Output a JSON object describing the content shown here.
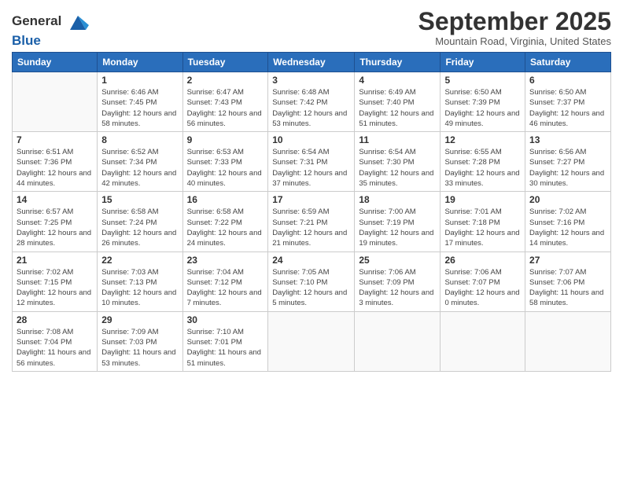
{
  "header": {
    "logo_line1": "General",
    "logo_line2": "Blue",
    "month": "September 2025",
    "location": "Mountain Road, Virginia, United States"
  },
  "weekdays": [
    "Sunday",
    "Monday",
    "Tuesday",
    "Wednesday",
    "Thursday",
    "Friday",
    "Saturday"
  ],
  "weeks": [
    [
      {
        "day": "",
        "empty": true
      },
      {
        "day": "1",
        "sunrise": "Sunrise: 6:46 AM",
        "sunset": "Sunset: 7:45 PM",
        "daylight": "Daylight: 12 hours and 58 minutes."
      },
      {
        "day": "2",
        "sunrise": "Sunrise: 6:47 AM",
        "sunset": "Sunset: 7:43 PM",
        "daylight": "Daylight: 12 hours and 56 minutes."
      },
      {
        "day": "3",
        "sunrise": "Sunrise: 6:48 AM",
        "sunset": "Sunset: 7:42 PM",
        "daylight": "Daylight: 12 hours and 53 minutes."
      },
      {
        "day": "4",
        "sunrise": "Sunrise: 6:49 AM",
        "sunset": "Sunset: 7:40 PM",
        "daylight": "Daylight: 12 hours and 51 minutes."
      },
      {
        "day": "5",
        "sunrise": "Sunrise: 6:50 AM",
        "sunset": "Sunset: 7:39 PM",
        "daylight": "Daylight: 12 hours and 49 minutes."
      },
      {
        "day": "6",
        "sunrise": "Sunrise: 6:50 AM",
        "sunset": "Sunset: 7:37 PM",
        "daylight": "Daylight: 12 hours and 46 minutes."
      }
    ],
    [
      {
        "day": "7",
        "sunrise": "Sunrise: 6:51 AM",
        "sunset": "Sunset: 7:36 PM",
        "daylight": "Daylight: 12 hours and 44 minutes."
      },
      {
        "day": "8",
        "sunrise": "Sunrise: 6:52 AM",
        "sunset": "Sunset: 7:34 PM",
        "daylight": "Daylight: 12 hours and 42 minutes."
      },
      {
        "day": "9",
        "sunrise": "Sunrise: 6:53 AM",
        "sunset": "Sunset: 7:33 PM",
        "daylight": "Daylight: 12 hours and 40 minutes."
      },
      {
        "day": "10",
        "sunrise": "Sunrise: 6:54 AM",
        "sunset": "Sunset: 7:31 PM",
        "daylight": "Daylight: 12 hours and 37 minutes."
      },
      {
        "day": "11",
        "sunrise": "Sunrise: 6:54 AM",
        "sunset": "Sunset: 7:30 PM",
        "daylight": "Daylight: 12 hours and 35 minutes."
      },
      {
        "day": "12",
        "sunrise": "Sunrise: 6:55 AM",
        "sunset": "Sunset: 7:28 PM",
        "daylight": "Daylight: 12 hours and 33 minutes."
      },
      {
        "day": "13",
        "sunrise": "Sunrise: 6:56 AM",
        "sunset": "Sunset: 7:27 PM",
        "daylight": "Daylight: 12 hours and 30 minutes."
      }
    ],
    [
      {
        "day": "14",
        "sunrise": "Sunrise: 6:57 AM",
        "sunset": "Sunset: 7:25 PM",
        "daylight": "Daylight: 12 hours and 28 minutes."
      },
      {
        "day": "15",
        "sunrise": "Sunrise: 6:58 AM",
        "sunset": "Sunset: 7:24 PM",
        "daylight": "Daylight: 12 hours and 26 minutes."
      },
      {
        "day": "16",
        "sunrise": "Sunrise: 6:58 AM",
        "sunset": "Sunset: 7:22 PM",
        "daylight": "Daylight: 12 hours and 24 minutes."
      },
      {
        "day": "17",
        "sunrise": "Sunrise: 6:59 AM",
        "sunset": "Sunset: 7:21 PM",
        "daylight": "Daylight: 12 hours and 21 minutes."
      },
      {
        "day": "18",
        "sunrise": "Sunrise: 7:00 AM",
        "sunset": "Sunset: 7:19 PM",
        "daylight": "Daylight: 12 hours and 19 minutes."
      },
      {
        "day": "19",
        "sunrise": "Sunrise: 7:01 AM",
        "sunset": "Sunset: 7:18 PM",
        "daylight": "Daylight: 12 hours and 17 minutes."
      },
      {
        "day": "20",
        "sunrise": "Sunrise: 7:02 AM",
        "sunset": "Sunset: 7:16 PM",
        "daylight": "Daylight: 12 hours and 14 minutes."
      }
    ],
    [
      {
        "day": "21",
        "sunrise": "Sunrise: 7:02 AM",
        "sunset": "Sunset: 7:15 PM",
        "daylight": "Daylight: 12 hours and 12 minutes."
      },
      {
        "day": "22",
        "sunrise": "Sunrise: 7:03 AM",
        "sunset": "Sunset: 7:13 PM",
        "daylight": "Daylight: 12 hours and 10 minutes."
      },
      {
        "day": "23",
        "sunrise": "Sunrise: 7:04 AM",
        "sunset": "Sunset: 7:12 PM",
        "daylight": "Daylight: 12 hours and 7 minutes."
      },
      {
        "day": "24",
        "sunrise": "Sunrise: 7:05 AM",
        "sunset": "Sunset: 7:10 PM",
        "daylight": "Daylight: 12 hours and 5 minutes."
      },
      {
        "day": "25",
        "sunrise": "Sunrise: 7:06 AM",
        "sunset": "Sunset: 7:09 PM",
        "daylight": "Daylight: 12 hours and 3 minutes."
      },
      {
        "day": "26",
        "sunrise": "Sunrise: 7:06 AM",
        "sunset": "Sunset: 7:07 PM",
        "daylight": "Daylight: 12 hours and 0 minutes."
      },
      {
        "day": "27",
        "sunrise": "Sunrise: 7:07 AM",
        "sunset": "Sunset: 7:06 PM",
        "daylight": "Daylight: 11 hours and 58 minutes."
      }
    ],
    [
      {
        "day": "28",
        "sunrise": "Sunrise: 7:08 AM",
        "sunset": "Sunset: 7:04 PM",
        "daylight": "Daylight: 11 hours and 56 minutes."
      },
      {
        "day": "29",
        "sunrise": "Sunrise: 7:09 AM",
        "sunset": "Sunset: 7:03 PM",
        "daylight": "Daylight: 11 hours and 53 minutes."
      },
      {
        "day": "30",
        "sunrise": "Sunrise: 7:10 AM",
        "sunset": "Sunset: 7:01 PM",
        "daylight": "Daylight: 11 hours and 51 minutes."
      },
      {
        "day": "",
        "empty": true
      },
      {
        "day": "",
        "empty": true
      },
      {
        "day": "",
        "empty": true
      },
      {
        "day": "",
        "empty": true
      }
    ]
  ]
}
